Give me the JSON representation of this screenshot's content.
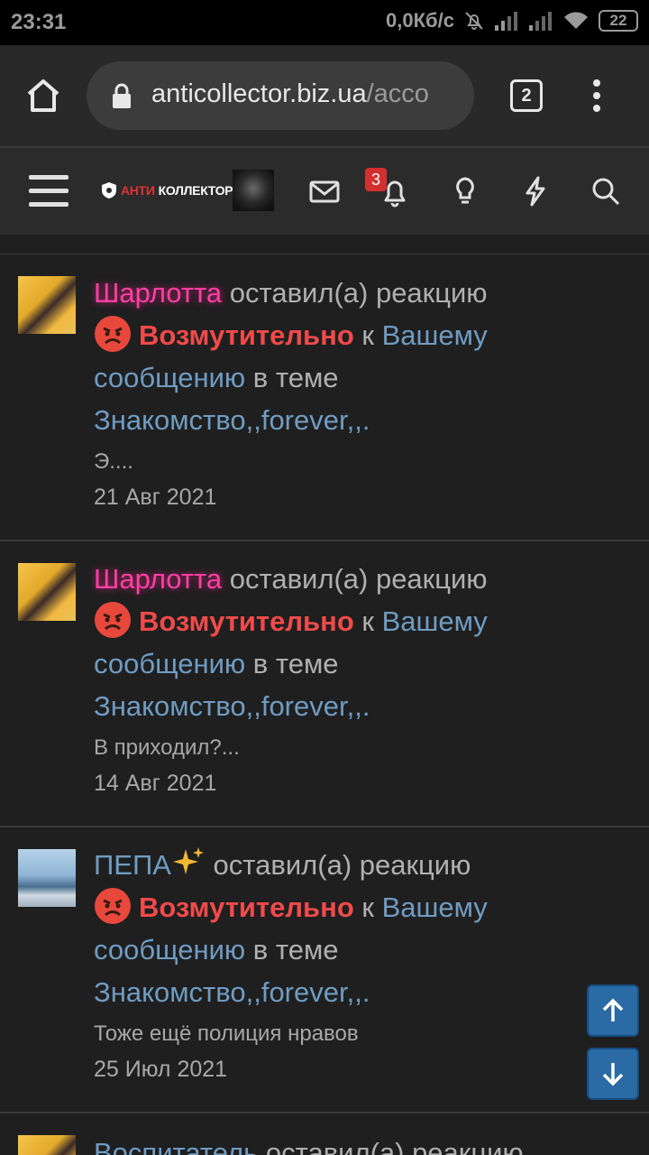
{
  "status_bar": {
    "time": "23:31",
    "net_speed": "0,0Кб/с",
    "battery": "22"
  },
  "browser": {
    "url_main": "anticollector.biz.ua",
    "url_rest": "/acco",
    "tab_count": "2"
  },
  "site_header": {
    "logo_red": "АНТИ",
    "logo_white": "КОЛЛЕКТОР",
    "alerts_badge": "3"
  },
  "notifications": [
    {
      "user": "Шарлотта",
      "action": "оставил(а) реакцию",
      "reaction": "Возмутительно",
      "to": "к",
      "link1": "Вашему",
      "link2": "сообщению",
      "in_topic": "в теме",
      "topic": "Знакомство,,forever,,.",
      "snippet": "Э....",
      "date": "21 Авг 2021"
    },
    {
      "user": "Шарлотта",
      "action": "оставил(а) реакцию",
      "reaction": "Возмутительно",
      "to": "к",
      "link1": "Вашему",
      "link2": "сообщению",
      "in_topic": "в теме",
      "topic": "Знакомство,,forever,,.",
      "snippet": "В приходил?...",
      "date": "14 Авг 2021"
    },
    {
      "user": "ПЕПА",
      "action": "оставил(а) реакцию",
      "reaction": "Возмутительно",
      "to": "к",
      "link1": "Вашему",
      "link2": "сообщению",
      "in_topic": "в теме",
      "topic": "Знакомство,,forever,,.",
      "snippet": "Тоже ещё полиция нравов",
      "date": "25 Июл 2021"
    },
    {
      "user": "Воспитатель",
      "action": "оставил(а) реакцию"
    }
  ]
}
